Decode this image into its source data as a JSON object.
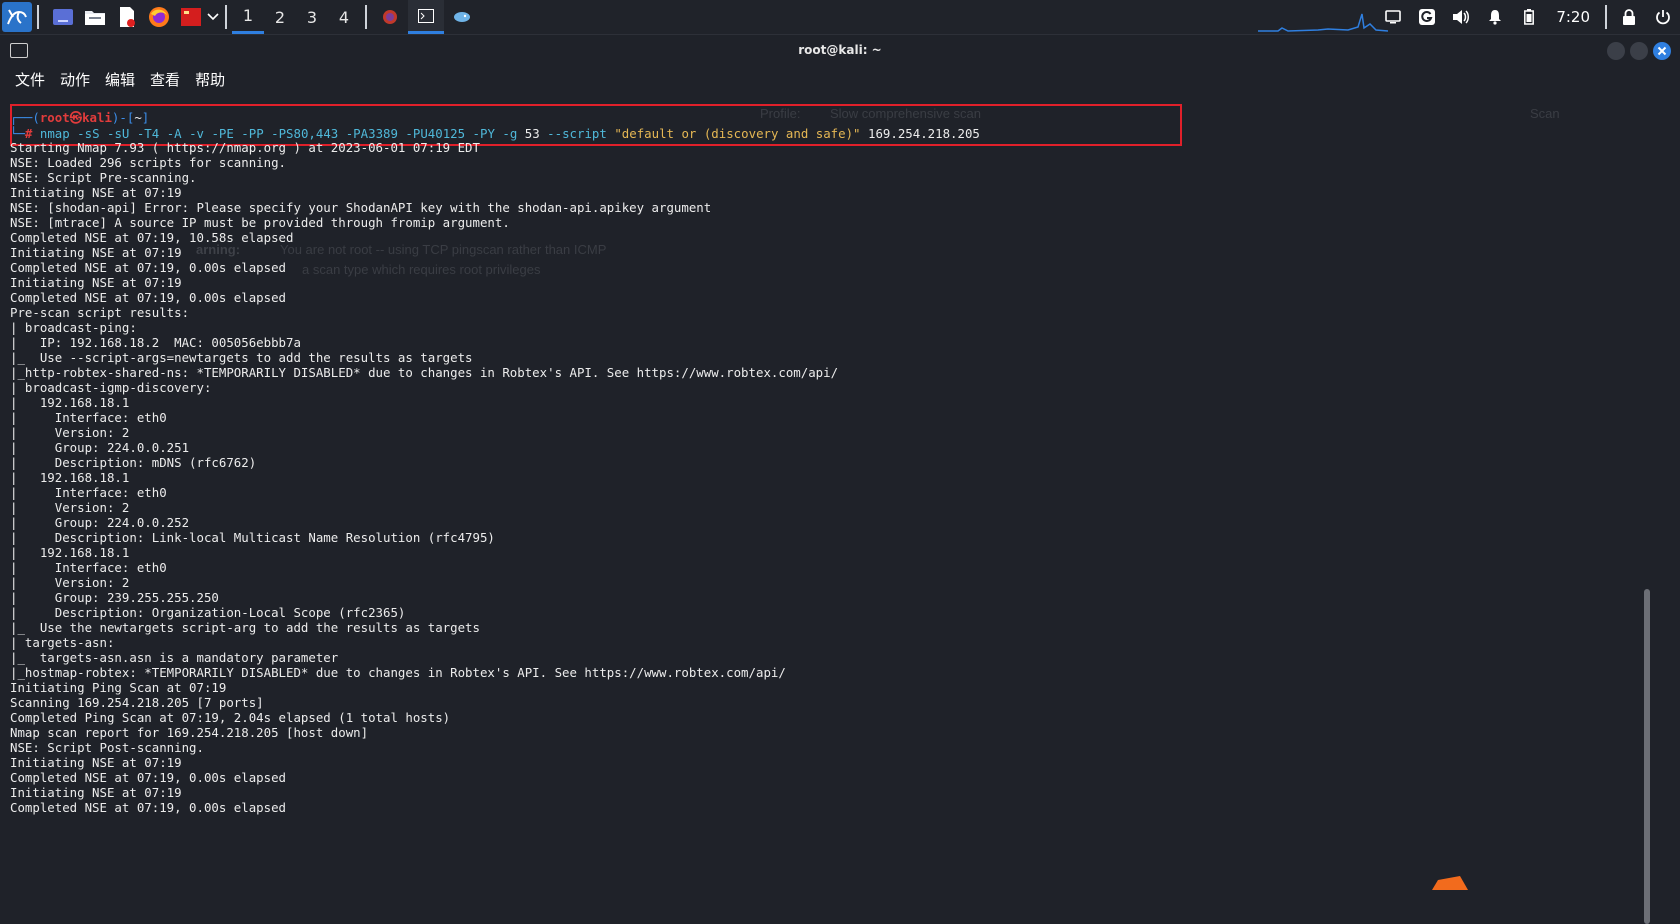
{
  "taskbar": {
    "workspaces": [
      "1",
      "2",
      "3",
      "4"
    ],
    "active_workspace": "1",
    "clock": "7:20",
    "icons": [
      "kali-menu-icon",
      "desktop-icon",
      "file-manager-icon",
      "text-editor-icon",
      "firefox-icon",
      "screenshot-tool-icon",
      "dropdown-icon"
    ],
    "running_apps": [
      "firefox-task",
      "terminal-task",
      "zenmap-task"
    ],
    "tray_icons": [
      "display-icon",
      "g-app-icon",
      "volume-icon",
      "notification-bell-icon",
      "battery-icon",
      "lock-icon",
      "power-icon"
    ]
  },
  "window": {
    "title": "root@kali: ~"
  },
  "menubar": {
    "items": [
      "文件",
      "动作",
      "编辑",
      "查看",
      "帮助"
    ]
  },
  "prompt": {
    "line1_prefix": "┌──(",
    "user": "root㉿kali",
    "line1_mid": ")-[",
    "path": "~",
    "line1_suffix": "]",
    "line2_prefix": "└─",
    "hash": "#",
    "cmd": "nmap",
    "args": "-sS -sU -T4 -A -v -PE -PP -PS80,443 -PA3389 -PU40125 -PY -g",
    "port": "53",
    "script_flag": "--script",
    "script_value": "\"default or (discovery and safe)\"",
    "target": "169.254.218.205"
  },
  "output_lines": [
    "Starting Nmap 7.93 ( https://nmap.org ) at 2023-06-01 07:19 EDT",
    "NSE: Loaded 296 scripts for scanning.",
    "NSE: Script Pre-scanning.",
    "Initiating NSE at 07:19",
    "NSE: [shodan-api] Error: Please specify your ShodanAPI key with the shodan-api.apikey argument",
    "NSE: [mtrace] A source IP must be provided through fromip argument.",
    "Completed NSE at 07:19, 10.58s elapsed",
    "Initiating NSE at 07:19",
    "Completed NSE at 07:19, 0.00s elapsed",
    "Initiating NSE at 07:19",
    "Completed NSE at 07:19, 0.00s elapsed",
    "Pre-scan script results:",
    "| broadcast-ping:",
    "|   IP: 192.168.18.2  MAC: 005056ebbb7a",
    "|_  Use --script-args=newtargets to add the results as targets",
    "|_http-robtex-shared-ns: *TEMPORARILY DISABLED* due to changes in Robtex's API. See https://www.robtex.com/api/",
    "| broadcast-igmp-discovery:",
    "|   192.168.18.1",
    "|     Interface: eth0",
    "|     Version: 2",
    "|     Group: 224.0.0.251",
    "|     Description: mDNS (rfc6762)",
    "|   192.168.18.1",
    "|     Interface: eth0",
    "|     Version: 2",
    "|     Group: 224.0.0.252",
    "|     Description: Link-local Multicast Name Resolution (rfc4795)",
    "|   192.168.18.1",
    "|     Interface: eth0",
    "|     Version: 2",
    "|     Group: 239.255.255.250",
    "|     Description: Organization-Local Scope (rfc2365)",
    "|_  Use the newtargets script-arg to add the results as targets",
    "| targets-asn:",
    "|_  targets-asn.asn is a mandatory parameter",
    "|_hostmap-robtex: *TEMPORARILY DISABLED* due to changes in Robtex's API. See https://www.robtex.com/api/",
    "Initiating Ping Scan at 07:19",
    "Scanning 169.254.218.205 [7 ports]",
    "Completed Ping Scan at 07:19, 2.04s elapsed (1 total hosts)",
    "Nmap scan report for 169.254.218.205 [host down]",
    "NSE: Script Post-scanning.",
    "Initiating NSE at 07:19",
    "Completed NSE at 07:19, 0.00s elapsed",
    "Initiating NSE at 07:19",
    "Completed NSE at 07:19, 0.00s elapsed"
  ],
  "background_ghost_text": {
    "t1": "Profile:",
    "t2": "Slow comprehensive scan",
    "t3": "Scan",
    "t4": "arning:",
    "t5": "You are not root -- using TCP pingscan rather than ICMP",
    "t6": "a scan type which requires root privileges"
  },
  "colors": {
    "prompt_blue": "#3b8eea",
    "prompt_red": "#e23c3c",
    "highlight_box": "#e0202a",
    "string_yellow": "#e5b754",
    "active_accent": "#2f7fe0"
  }
}
